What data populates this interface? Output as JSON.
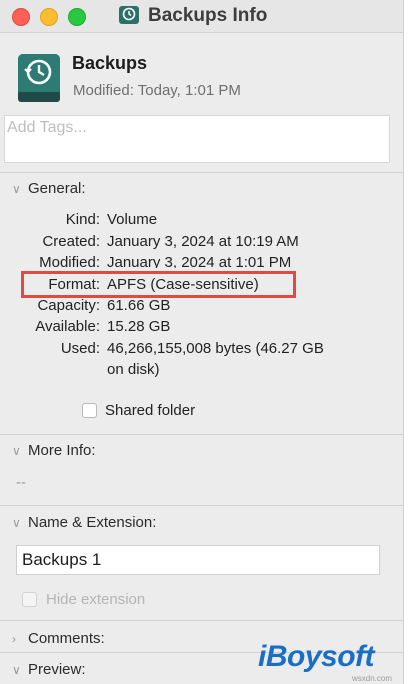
{
  "window": {
    "title": "Backups Info"
  },
  "header": {
    "name": "Backups",
    "modified": "Modified:  Today, 1:01 PM",
    "tags_placeholder": "Add Tags..."
  },
  "general": {
    "heading": "General:",
    "rows": [
      {
        "label": "Kind:",
        "value": "Volume"
      },
      {
        "label": "Created:",
        "value": "January 3, 2024 at 10:19 AM"
      },
      {
        "label": "Modified:",
        "value": "January 3, 2024 at 1:01 PM"
      },
      {
        "label": "Format:",
        "value": "APFS (Case-sensitive)"
      },
      {
        "label": "Capacity:",
        "value": "61.66 GB"
      },
      {
        "label": "Available:",
        "value": "15.28 GB"
      },
      {
        "label": "Used:",
        "value": "46,266,155,008 bytes (46.27 GB",
        "value2": "on disk)"
      }
    ],
    "shared_folder_label": "Shared folder"
  },
  "more_info": {
    "heading": "More Info:",
    "value": "--"
  },
  "name_ext": {
    "heading": "Name & Extension:",
    "name_value": "Backups 1",
    "hide_extension_label": "Hide extension"
  },
  "comments": {
    "heading": "Comments:"
  },
  "preview": {
    "heading": "Preview:"
  },
  "watermark": {
    "text": "iBoysoft",
    "small": "wsxdn.com"
  },
  "colors": {
    "highlight": "#e04b41",
    "watermark": "#1a6ec4",
    "close": "#fe5f57",
    "minimize": "#febc2e",
    "maximize": "#28c840"
  }
}
